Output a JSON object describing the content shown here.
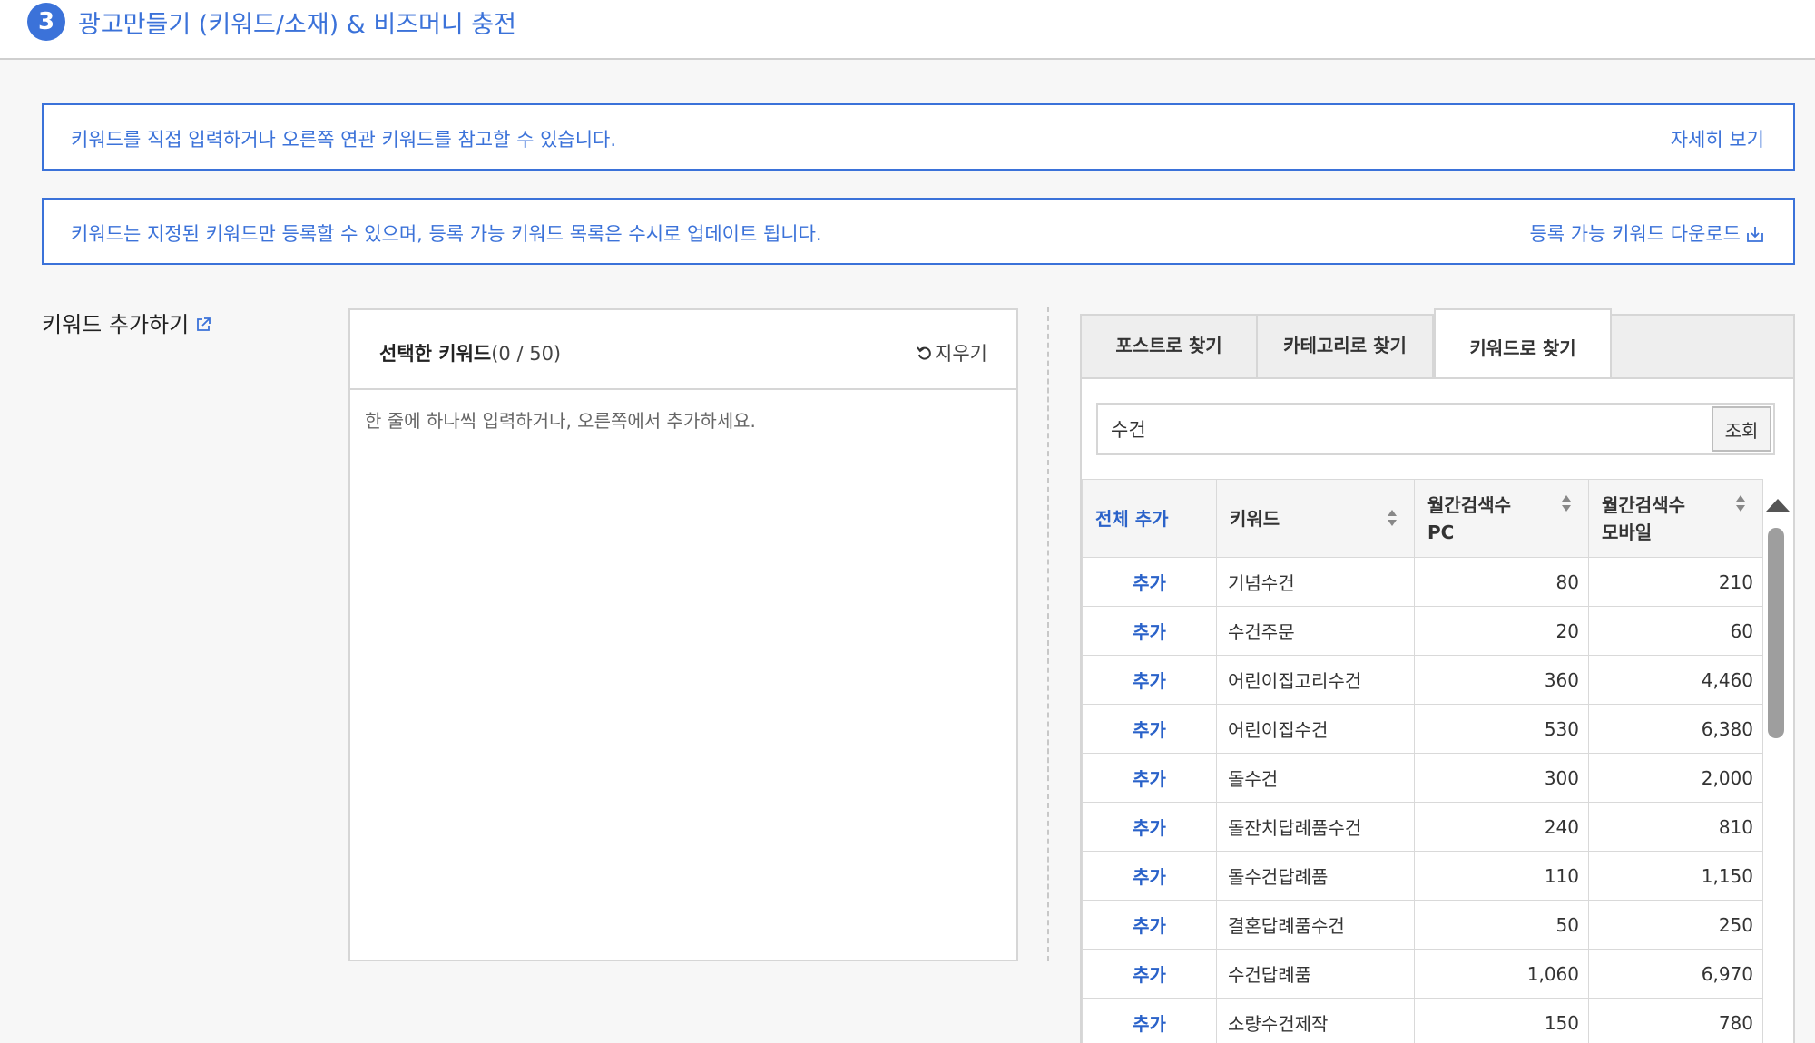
{
  "header": {
    "step_number": "3",
    "title": "광고만들기 (키워드/소재) & 비즈머니 충전"
  },
  "notices": [
    {
      "text": "키워드를 직접 입력하거나 오른쪽 연관 키워드를 참고할 수 있습니다.",
      "link": "자세히 보기"
    },
    {
      "text": "키워드는 지정된 키워드만 등록할 수 있으며, 등록 가능 키워드 목록은 수시로 업데이트 됩니다.",
      "link": "등록 가능 키워드 다운로드"
    }
  ],
  "section": {
    "label": "키워드 추가하기"
  },
  "selected": {
    "title": "선택한 키워드",
    "count": "(0 / 50)",
    "clear_label": "지우기",
    "placeholder": "한 줄에 하나씩 입력하거나, 오른쪽에서 추가하세요."
  },
  "tabs": [
    {
      "label": "포스트로 찾기",
      "active": false
    },
    {
      "label": "카테고리로 찾기",
      "active": false
    },
    {
      "label": "키워드로 찾기",
      "active": true
    }
  ],
  "search": {
    "value": "수건",
    "button_label": "조회"
  },
  "table": {
    "headers": {
      "add_all": "전체 추가",
      "keyword": "키워드",
      "pc_line1": "월간검색수",
      "pc_line2": "PC",
      "mobile_line1": "월간검색수",
      "mobile_line2": "모바일"
    },
    "rows": [
      {
        "add": "추가",
        "keyword": "기념수건",
        "pc": "80",
        "mobile": "210"
      },
      {
        "add": "추가",
        "keyword": "수건주문",
        "pc": "20",
        "mobile": "60"
      },
      {
        "add": "추가",
        "keyword": "어린이집고리수건",
        "pc": "360",
        "mobile": "4,460"
      },
      {
        "add": "추가",
        "keyword": "어린이집수건",
        "pc": "530",
        "mobile": "6,380"
      },
      {
        "add": "추가",
        "keyword": "돌수건",
        "pc": "300",
        "mobile": "2,000"
      },
      {
        "add": "추가",
        "keyword": "돌잔치답례품수건",
        "pc": "240",
        "mobile": "810"
      },
      {
        "add": "추가",
        "keyword": "돌수건답례품",
        "pc": "110",
        "mobile": "1,150"
      },
      {
        "add": "추가",
        "keyword": "결혼답례품수건",
        "pc": "50",
        "mobile": "250"
      },
      {
        "add": "추가",
        "keyword": "수건답례품",
        "pc": "1,060",
        "mobile": "6,970"
      },
      {
        "add": "추가",
        "keyword": "소량수건제작",
        "pc": "150",
        "mobile": "780"
      }
    ]
  },
  "colors": {
    "accent": "#3b72d9",
    "link": "#2a62c9",
    "border": "#d6d6d6"
  }
}
